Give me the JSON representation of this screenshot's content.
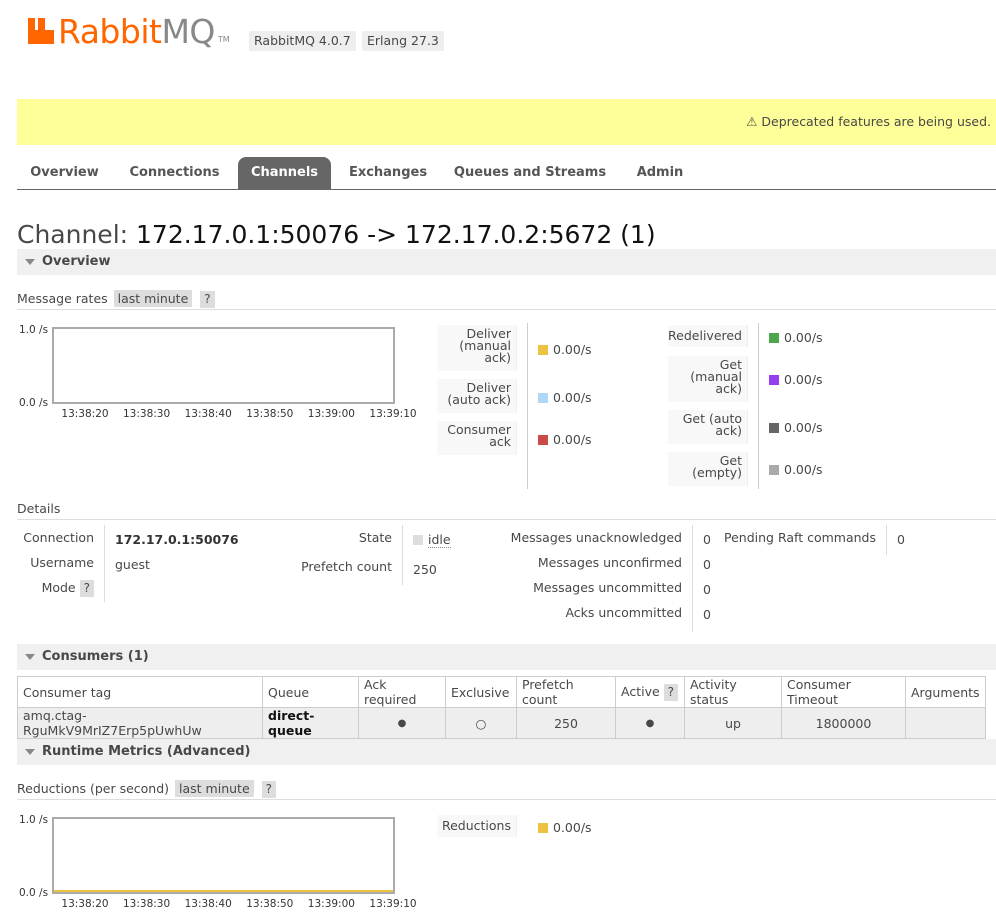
{
  "header": {
    "logo_text_a": "Rabbit",
    "logo_text_b": "MQ",
    "logo_tm": "TM",
    "version_badge": "RabbitMQ 4.0.7",
    "erlang_badge": "Erlang 27.3"
  },
  "warning": "⚠ Deprecated features are being used.",
  "tabs": [
    "Overview",
    "Connections",
    "Channels",
    "Exchanges",
    "Queues and Streams",
    "Admin"
  ],
  "active_tab": "Channels",
  "page_title_prefix": "Channel:",
  "page_title_name": "172.17.0.1:50076 -> 172.17.0.2:5672 (1)",
  "overview_section": "Overview",
  "message_rates": {
    "label": "Message rates",
    "range": "last minute",
    "help": "?",
    "chart_data": {
      "type": "line",
      "x": [
        "13:38:20",
        "13:38:30",
        "13:38:40",
        "13:38:50",
        "13:39:00",
        "13:39:10"
      ],
      "y_top": "1.0 /s",
      "y_bottom": "0.0 /s",
      "ylim": [
        0,
        1
      ],
      "series": [
        {
          "name": "Deliver (manual ack)",
          "color": "#edc240",
          "rate": "0.00/s"
        },
        {
          "name": "Deliver (auto ack)",
          "color": "#afd8f8",
          "rate": "0.00/s"
        },
        {
          "name": "Consumer ack",
          "color": "#cb4b4b",
          "rate": "0.00/s"
        },
        {
          "name": "Redelivered",
          "color": "#4da74d",
          "rate": "0.00/s"
        },
        {
          "name": "Get (manual ack)",
          "color": "#9440ed",
          "rate": "0.00/s"
        },
        {
          "name": "Get (auto ack)",
          "color": "#666666",
          "rate": "0.00/s"
        },
        {
          "name": "Get (empty)",
          "color": "#aaaaaa",
          "rate": "0.00/s"
        }
      ]
    },
    "legend_lines": {
      "deliver_manual": [
        "Deliver",
        "(manual",
        "ack)"
      ],
      "deliver_auto": [
        "Deliver",
        "(auto ack)"
      ],
      "consumer_ack": [
        "Consumer",
        "ack"
      ],
      "redelivered": [
        "Redelivered"
      ],
      "get_manual": [
        "Get",
        "(manual",
        "ack)"
      ],
      "get_auto": [
        "Get (auto",
        "ack)"
      ],
      "get_empty": [
        "Get",
        "(empty)"
      ]
    }
  },
  "details": {
    "label": "Details",
    "connection_label": "Connection",
    "connection_value": "172.17.0.1:50076",
    "username_label": "Username",
    "username_value": "guest",
    "mode_label": "Mode",
    "mode_help": "?",
    "state_label": "State",
    "state_value": "idle",
    "prefetch_label": "Prefetch count",
    "prefetch_value": "250",
    "unacked_label": "Messages unacknowledged",
    "unacked_value": "0",
    "unconfirmed_label": "Messages unconfirmed",
    "unconfirmed_value": "0",
    "uncommitted_label": "Messages uncommitted",
    "uncommitted_value": "0",
    "acks_uncommitted_label": "Acks uncommitted",
    "acks_uncommitted_value": "0",
    "raft_label": "Pending Raft commands",
    "raft_value": "0"
  },
  "consumers": {
    "section": "Consumers (1)",
    "columns": [
      "Consumer tag",
      "Queue",
      "Ack required",
      "Exclusive",
      "Prefetch count",
      "Active",
      "Activity status",
      "Consumer Timeout",
      "Arguments"
    ],
    "active_help": "?",
    "rows": [
      {
        "tag": "amq.ctag-RguMkV9MrIZ7Erp5pUwhUw",
        "queue": "direct-queue",
        "ack_required": "●",
        "exclusive": "○",
        "prefetch": "250",
        "active": "●",
        "status": "up",
        "timeout": "1800000",
        "arguments": ""
      }
    ]
  },
  "runtime": {
    "section": "Runtime Metrics (Advanced)",
    "label": "Reductions (per second)",
    "range": "last minute",
    "help": "?",
    "chart_data": {
      "type": "line",
      "x": [
        "13:38:20",
        "13:38:30",
        "13:38:40",
        "13:38:50",
        "13:39:00",
        "13:39:10"
      ],
      "y_top": "1.0 /s",
      "y_bottom": "0.0 /s",
      "ylim": [
        0,
        1
      ],
      "series": [
        {
          "name": "Reductions",
          "color": "#edc240",
          "rate": "0.00/s",
          "values": [
            0,
            0,
            0,
            0,
            0,
            0
          ]
        }
      ]
    }
  }
}
